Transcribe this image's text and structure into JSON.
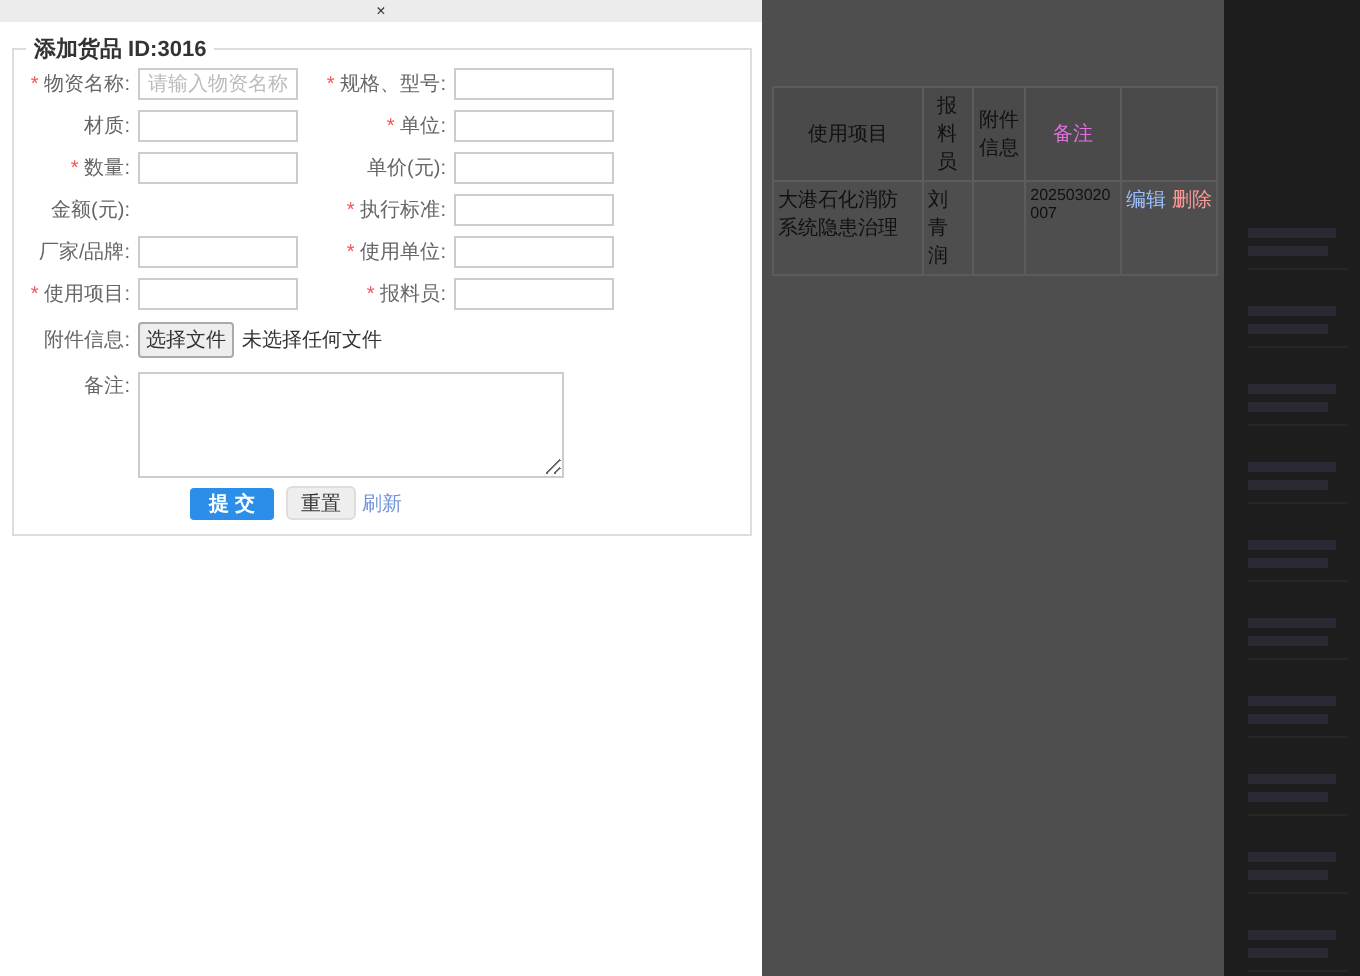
{
  "dialog": {
    "close": "×",
    "legend": "添加货品 ID:3016",
    "required_mark": "*",
    "fields": [
      {
        "label": "物资名称:",
        "required": true,
        "kind": "input",
        "placeholder": "请输入物资名称"
      },
      {
        "label": "规格、型号:",
        "required": true,
        "kind": "input"
      },
      {
        "label": "材质:",
        "required": false,
        "kind": "input"
      },
      {
        "label": "单位:",
        "required": true,
        "kind": "input"
      },
      {
        "label": "数量:",
        "required": true,
        "kind": "input"
      },
      {
        "label": "单价(元):",
        "required": false,
        "kind": "input"
      },
      {
        "label": "金额(元):",
        "required": false,
        "kind": "static"
      },
      {
        "label": "执行标准:",
        "required": true,
        "kind": "input"
      },
      {
        "label": "厂家/品牌:",
        "required": false,
        "kind": "input"
      },
      {
        "label": "使用单位:",
        "required": true,
        "kind": "input"
      },
      {
        "label": "使用项目:",
        "required": true,
        "kind": "input"
      },
      {
        "label": "报料员:",
        "required": true,
        "kind": "input"
      }
    ],
    "attachment": {
      "label": "附件信息:",
      "button": "选择文件",
      "status": "未选择任何文件"
    },
    "note": {
      "label": "备注:"
    },
    "submit": "提 交",
    "reset": "重置",
    "refresh": "刷新"
  },
  "background_table": {
    "columns": [
      "使用项目",
      "报料员",
      "附件信息",
      "备注",
      ""
    ],
    "rows": [
      {
        "cells": [
          "大港石化消防系统隐患治理",
          "刘青润",
          "",
          "202503020007"
        ],
        "edit": "编辑",
        "delete": "删除"
      }
    ]
  },
  "side_list": {
    "cards": [
      {
        "kind": "blurred"
      },
      {
        "kind": "blurred"
      },
      {
        "kind": "blurred"
      },
      {
        "kind": "blurred"
      },
      {
        "kind": "blurred"
      },
      {
        "kind": "blurred"
      },
      {
        "kind": "blurred"
      },
      {
        "kind": "blurred"
      },
      {
        "kind": "blurred"
      },
      {
        "kind": "blurred"
      }
    ]
  }
}
